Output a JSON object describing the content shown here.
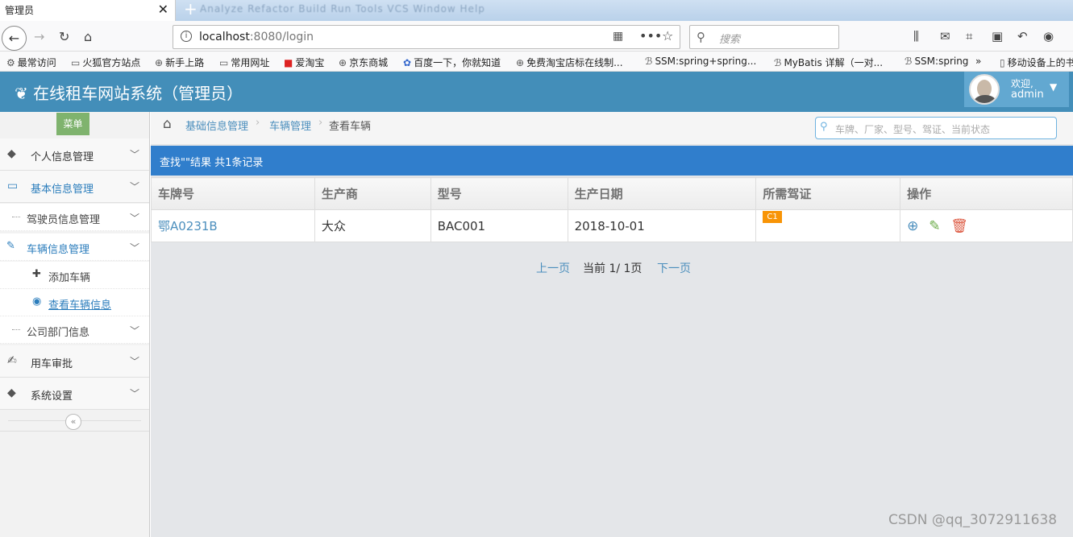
{
  "browser": {
    "tab_title": "管理员",
    "tab_close": "✕",
    "new_tab": "+",
    "ghost_menu": "Analyze Refactor Build Run Tools VCS Window Help",
    "url_host": "localhost",
    "url_rest": ":8080/login",
    "search_placeholder": "搜索",
    "bookmarks": [
      "最常访问",
      "火狐官方站点",
      "新手上路",
      "常用网址",
      "爱淘宝",
      "京东商城",
      "百度一下，你就知道",
      "免费淘宝店标在线制...",
      "SSM:spring+spring...",
      "MyBatis 详解（一对...",
      "SSM:spring",
      "移动设备上的书"
    ]
  },
  "app": {
    "title": "在线租车网站系统（管理员）",
    "welcome": "欢迎,",
    "username": "admin"
  },
  "sidebar": {
    "menu_label": "菜单",
    "items": {
      "personal": "个人信息管理",
      "basic": "基本信息管理",
      "driver": "驾驶员信息管理",
      "vehicle": "车辆信息管理",
      "add_vehicle": "添加车辆",
      "view_vehicle": "查看车辆信息",
      "department": "公司部门信息",
      "approval": "用车审批",
      "settings": "系统设置"
    }
  },
  "breadcrumb": {
    "level1": "基础信息管理",
    "level2": "车辆管理",
    "level3": "查看车辆"
  },
  "nav_search_placeholder": "车牌、厂家、型号、驾证、当前状态",
  "results_header": "查找\"\"结果 共1条记录",
  "table": {
    "headers": [
      "车牌号",
      "生产商",
      "型号",
      "生产日期",
      "所需驾证",
      "操作"
    ],
    "rows": [
      {
        "plate": "鄂A0231B",
        "maker": "大众",
        "model": "BAC001",
        "date": "2018-10-01",
        "license": "C1"
      }
    ]
  },
  "pager": {
    "prev": "上一页",
    "current": "当前 1/ 1页",
    "next": "下一页"
  },
  "watermark": "CSDN @qq_3072911638",
  "colors": {
    "header": "#438eb9",
    "result_bar": "#307ecc",
    "badge": "#f89406",
    "link": "#4c8fbd"
  }
}
